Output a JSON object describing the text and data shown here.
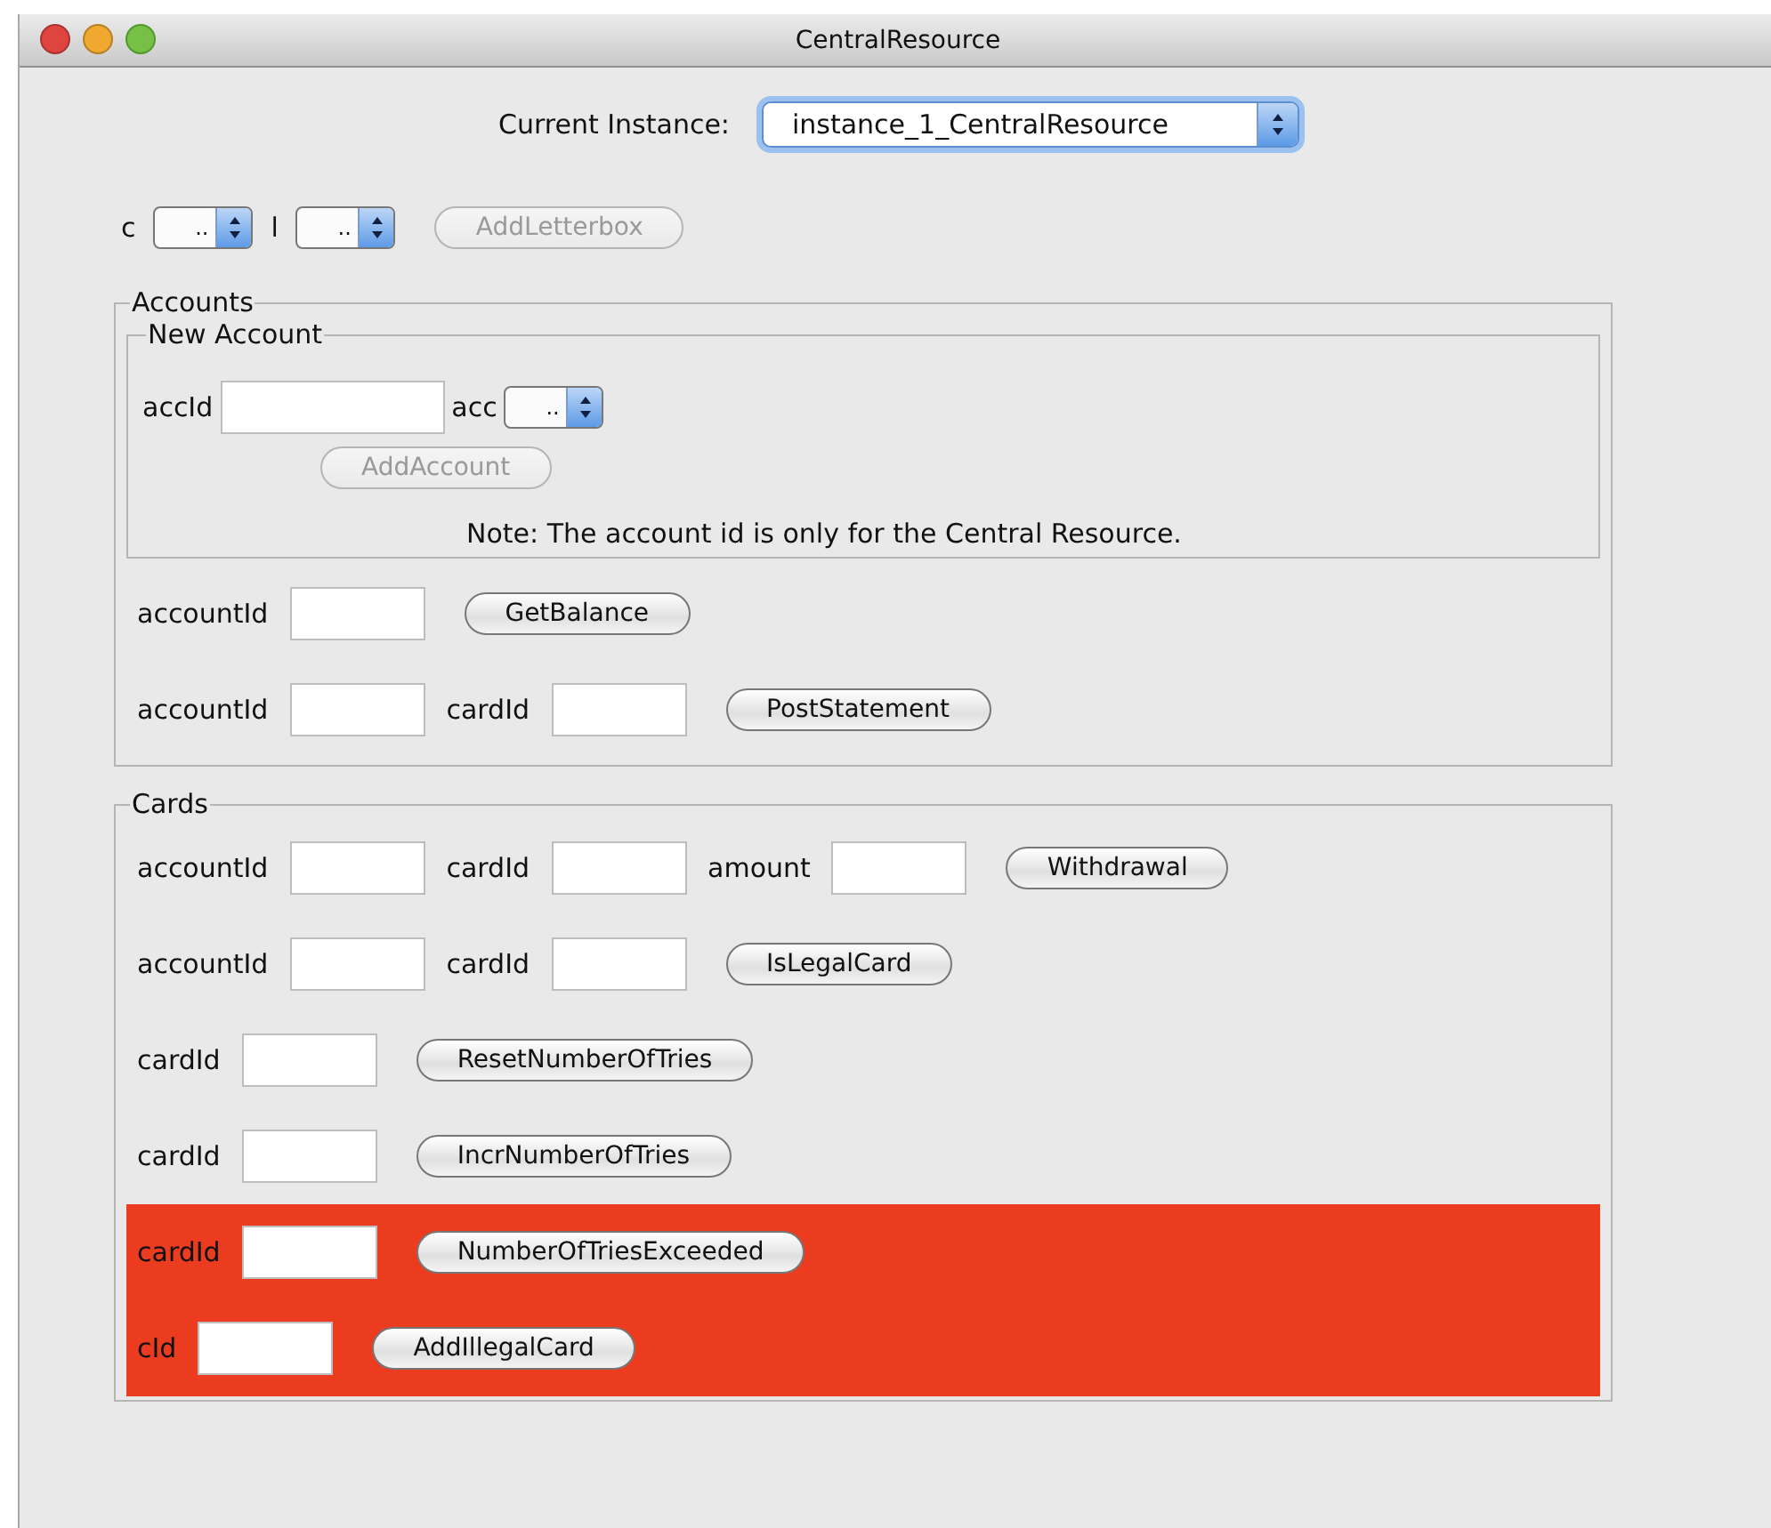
{
  "window": {
    "title": "CentralResource"
  },
  "instance": {
    "label": "Current Instance:",
    "value": "instance_1_CentralResource"
  },
  "top_row": {
    "items": [
      {
        "kind": "label",
        "text": "c"
      },
      {
        "kind": "select",
        "value": ".."
      },
      {
        "kind": "label",
        "text": "l"
      },
      {
        "kind": "select",
        "value": ".."
      },
      {
        "kind": "button",
        "text": "AddLetterbox",
        "disabled": true
      }
    ]
  },
  "accounts": {
    "title": "Accounts",
    "new_account": {
      "title": "New Account",
      "rows": [
        {
          "highlighted": false,
          "items": [
            {
              "kind": "label",
              "text": "accId"
            },
            {
              "kind": "wide-field"
            },
            {
              "kind": "label",
              "text": "acc"
            },
            {
              "kind": "select",
              "value": ".."
            }
          ]
        },
        {
          "highlighted": false,
          "items": [
            {
              "kind": "button",
              "text": "AddAccount",
              "disabled": true
            }
          ]
        }
      ],
      "note": "Note: The account id is only for the Central Resource."
    },
    "rows": [
      {
        "highlighted": false,
        "items": [
          {
            "kind": "label",
            "text": "accountId"
          },
          {
            "kind": "field"
          },
          {
            "kind": "button",
            "text": "GetBalance",
            "disabled": false
          }
        ]
      },
      {
        "highlighted": false,
        "items": [
          {
            "kind": "label",
            "text": "accountId"
          },
          {
            "kind": "field"
          },
          {
            "kind": "label",
            "text": "cardId"
          },
          {
            "kind": "field"
          },
          {
            "kind": "button",
            "text": "PostStatement",
            "disabled": false
          }
        ]
      }
    ]
  },
  "cards": {
    "title": "Cards",
    "rows": [
      {
        "highlighted": false,
        "items": [
          {
            "kind": "label",
            "text": "accountId"
          },
          {
            "kind": "field"
          },
          {
            "kind": "label",
            "text": "cardId"
          },
          {
            "kind": "field"
          },
          {
            "kind": "label",
            "text": "amount"
          },
          {
            "kind": "field"
          },
          {
            "kind": "button",
            "text": "Withdrawal",
            "disabled": false
          }
        ]
      },
      {
        "highlighted": false,
        "items": [
          {
            "kind": "label",
            "text": "accountId"
          },
          {
            "kind": "field"
          },
          {
            "kind": "label",
            "text": "cardId"
          },
          {
            "kind": "field"
          },
          {
            "kind": "button",
            "text": "IsLegalCard",
            "disabled": false
          }
        ]
      },
      {
        "highlighted": false,
        "items": [
          {
            "kind": "label",
            "text": "cardId"
          },
          {
            "kind": "field"
          },
          {
            "kind": "button",
            "text": "ResetNumberOfTries",
            "disabled": false
          }
        ]
      },
      {
        "highlighted": false,
        "items": [
          {
            "kind": "label",
            "text": "cardId"
          },
          {
            "kind": "field"
          },
          {
            "kind": "button",
            "text": "IncrNumberOfTries",
            "disabled": false
          }
        ]
      },
      {
        "highlighted": true,
        "items": [
          {
            "kind": "label",
            "text": "cardId"
          },
          {
            "kind": "field"
          },
          {
            "kind": "button",
            "text": "NumberOfTriesExceeded",
            "disabled": false
          }
        ]
      },
      {
        "highlighted": true,
        "items": [
          {
            "kind": "label",
            "text": "cId"
          },
          {
            "kind": "field"
          },
          {
            "kind": "button",
            "text": "AddIllegalCard",
            "disabled": false
          }
        ]
      }
    ]
  }
}
